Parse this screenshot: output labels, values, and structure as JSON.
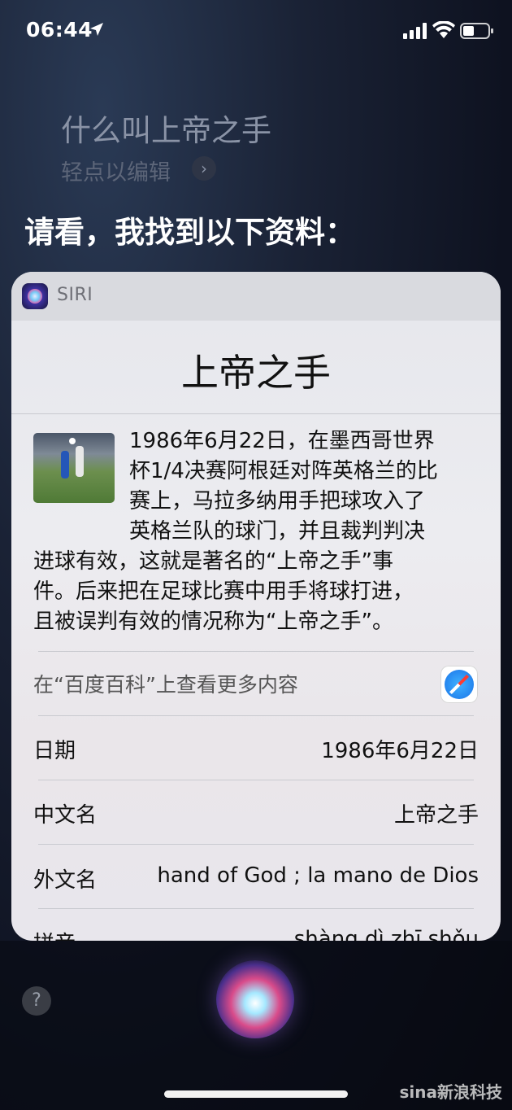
{
  "status": {
    "time": "06:44",
    "icons": [
      "location-arrow-icon",
      "cellular-signal-icon",
      "wifi-icon",
      "battery-icon"
    ]
  },
  "siri": {
    "query": "什么叫上帝之手",
    "edit_hint": "轻点以编辑",
    "answer_intro": "请看，我找到以下资料："
  },
  "card": {
    "source_label": "SIRI",
    "title": "上帝之手",
    "description_lines": [
      "1986年6月22日，在墨西哥世界",
      "杯1/4决赛阿根廷对阵英格兰的比",
      "赛上，马拉多纳用手把球攻入了",
      "英格兰队的球门，并且裁判判决",
      "进球有效，这就是著名的“上帝之手”事",
      "件。后来把在足球比赛中用手将球打进，",
      "且被误判有效的情况称为“上帝之手”。"
    ],
    "more_link": "在“百度百科”上查看更多内容",
    "facts": [
      {
        "key": "日期",
        "value": "1986年6月22日"
      },
      {
        "key": "中文名",
        "value": "上帝之手"
      },
      {
        "key": "外文名",
        "value": "hand of God ; la mano de Dios"
      },
      {
        "key": "拼音",
        "value": "shàng dì zhī shǒu"
      }
    ]
  },
  "bottom": {
    "help_label": "?",
    "watermark": "sina新浪科技"
  },
  "colors": {
    "card_background": "#ececf0",
    "card_header": "#d9dadf",
    "query_text": "#8a93a6"
  }
}
